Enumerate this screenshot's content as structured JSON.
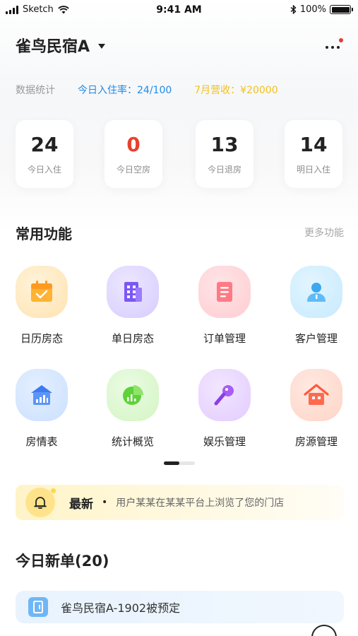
{
  "status_bar": {
    "carrier": "Sketch",
    "time": "9:41 AM",
    "battery": "100%",
    "battery_level": 1.0
  },
  "header": {
    "title": "雀鸟民宿A"
  },
  "stats": {
    "label": "数据统计",
    "occupancy": "今日入住率：24/100",
    "revenue": "7月营收：¥20000"
  },
  "cards": [
    {
      "value": "24",
      "label": "今日入住"
    },
    {
      "value": "0",
      "label": "今日空房"
    },
    {
      "value": "13",
      "label": "今日退房"
    },
    {
      "value": "14",
      "label": "明日入住"
    }
  ],
  "functions": {
    "title": "常用功能",
    "more": "更多功能",
    "items": [
      {
        "label": "日历房态",
        "icon": "calendar-icon"
      },
      {
        "label": "单日房态",
        "icon": "building-icon"
      },
      {
        "label": "订单管理",
        "icon": "document-icon"
      },
      {
        "label": "客户管理",
        "icon": "user-icon"
      },
      {
        "label": "房情表",
        "icon": "house-chart-icon"
      },
      {
        "label": "统计概览",
        "icon": "pie-chart-icon"
      },
      {
        "label": "娱乐管理",
        "icon": "microphone-icon"
      },
      {
        "label": "房源管理",
        "icon": "home-icon"
      }
    ]
  },
  "notice": {
    "title": "最新",
    "separator": "•",
    "text": "用户某某在某某平台上浏览了您的门店"
  },
  "orders": {
    "title": "今日新单(20)",
    "items": [
      {
        "text": "雀鸟民宿A-1902被预定"
      }
    ]
  },
  "colors": {
    "accent_blue": "#1e8ce8",
    "accent_yellow": "#f3c21a",
    "alert_red": "#e8412c"
  }
}
